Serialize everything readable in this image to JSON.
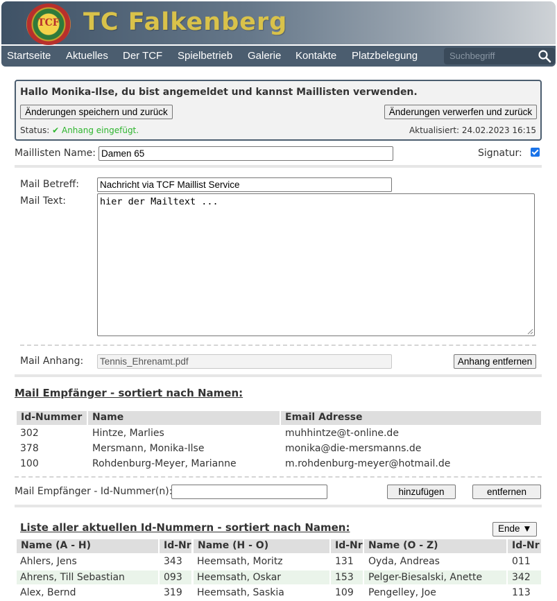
{
  "site": {
    "title": "TC Falkenberg",
    "logo_text": "TCF"
  },
  "nav": {
    "items": [
      "Startseite",
      "Aktuelles",
      "Der TCF",
      "Spielbetrieb",
      "Galerie",
      "Kontakte",
      "Platzbelegung"
    ],
    "search_placeholder": "Suchbegriff"
  },
  "panel": {
    "greeting": "Hallo Monika-Ilse, du bist angemeldet und kannst Maillisten verwenden.",
    "save_label": "Änderungen speichern und zurück",
    "discard_label": "Änderungen verwerfen und zurück",
    "status_label": "Status:",
    "status_value": "✔ Anhang eingefügt.",
    "updated": "Aktualisiert: 24.02.2023 16:15"
  },
  "form": {
    "list_name_label": "Maillisten Name:",
    "list_name_value": "Damen 65",
    "signature_label": "Signatur:",
    "signature_checked": true,
    "subject_label": "Mail Betreff:",
    "subject_value": "Nachricht via TCF Maillist Service",
    "text_label": "Mail Text:",
    "text_value": "hier der Mailtext ...",
    "attachment_label": "Mail Anhang:",
    "attachment_value": "Tennis_Ehrenamt.pdf",
    "remove_attachment_label": "Anhang entfernen"
  },
  "recipients": {
    "title": "Mail Empfänger - sortiert nach Namen:",
    "columns": [
      "Id-Nummer",
      "Name",
      "Email Adresse"
    ],
    "rows": [
      [
        "302",
        "Hintze, Marlies",
        "muhhintze@t-online.de"
      ],
      [
        "378",
        "Mersmann, Monika-Ilse",
        "monika@die-mersmanns.de"
      ],
      [
        "100",
        "Rohdenburg-Meyer, Marianne",
        "m.rohdenburg-meyer@hotmail.de"
      ]
    ],
    "id_input_label": "Mail Empfänger - Id-Nummer(n):",
    "id_input_value": "",
    "add_label": "hinzufügen",
    "remove_label": "entfernen"
  },
  "idlist": {
    "title": "Liste aller aktuellen Id-Nummern - sortiert nach Namen:",
    "dropdown_value": "Ende ▼",
    "columns": [
      "Name  (A - H)",
      "Id-Nr",
      "Name  (H - O)",
      "Id-Nr",
      "Name  (O - Z)",
      "Id-Nr"
    ],
    "rows": [
      [
        "Ahlers, Jens",
        "343",
        "Heemsath, Moritz",
        "131",
        "Oyda, Andreas",
        "011"
      ],
      [
        "Ahrens, Till Sebastian",
        "093",
        "Heemsath, Oskar",
        "153",
        "Pelger-Biesalski, Anette",
        "342"
      ],
      [
        "Alex, Bernd",
        "319",
        "Heemsath, Saskia",
        "109",
        "Pengelley, Joe",
        "113"
      ]
    ]
  }
}
